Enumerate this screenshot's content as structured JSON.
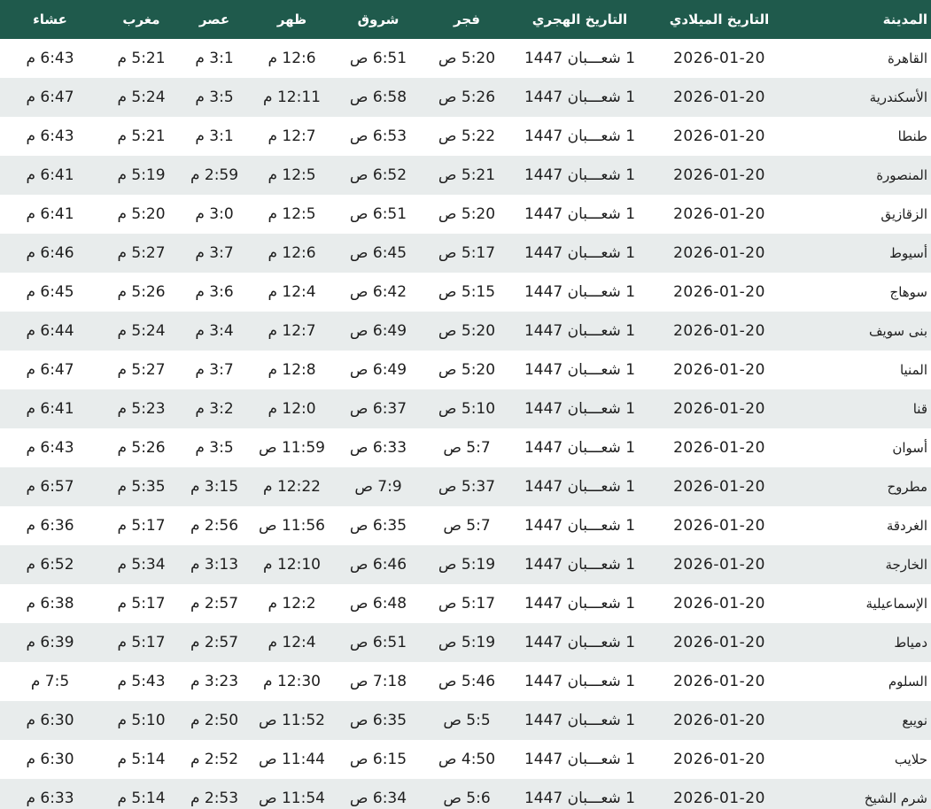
{
  "header": {
    "city": "المدينة",
    "gregorian": "التاريخ الميلادي",
    "hijri": "التاريخ الهجري",
    "fajr": "فجر",
    "sunrise": "شروق",
    "dhuhr": "ظهر",
    "asr": "عصر",
    "maghrib": "مغرب",
    "isha": "عشاء"
  },
  "rows": [
    {
      "city": "القاهرة",
      "gregorian": "2026-01-20",
      "hijri": "1 شعـــبان 1447",
      "fajr": "5:20 ص",
      "sunrise": "6:51 ص",
      "dhuhr": "12:6 م",
      "asr": "3:1 م",
      "maghrib": "5:21 م",
      "isha": "6:43 م"
    },
    {
      "city": "الأسكندرية",
      "gregorian": "2026-01-20",
      "hijri": "1 شعـــبان 1447",
      "fajr": "5:26 ص",
      "sunrise": "6:58 ص",
      "dhuhr": "12:11 م",
      "asr": "3:5 م",
      "maghrib": "5:24 م",
      "isha": "6:47 م"
    },
    {
      "city": "طنطا",
      "gregorian": "2026-01-20",
      "hijri": "1 شعـــبان 1447",
      "fajr": "5:22 ص",
      "sunrise": "6:53 ص",
      "dhuhr": "12:7 م",
      "asr": "3:1 م",
      "maghrib": "5:21 م",
      "isha": "6:43 م"
    },
    {
      "city": "المنصورة",
      "gregorian": "2026-01-20",
      "hijri": "1 شعـــبان 1447",
      "fajr": "5:21 ص",
      "sunrise": "6:52 ص",
      "dhuhr": "12:5 م",
      "asr": "2:59 م",
      "maghrib": "5:19 م",
      "isha": "6:41 م"
    },
    {
      "city": "الزقازيق",
      "gregorian": "2026-01-20",
      "hijri": "1 شعـــبان 1447",
      "fajr": "5:20 ص",
      "sunrise": "6:51 ص",
      "dhuhr": "12:5 م",
      "asr": "3:0 م",
      "maghrib": "5:20 م",
      "isha": "6:41 م"
    },
    {
      "city": "أسيوط",
      "gregorian": "2026-01-20",
      "hijri": "1 شعـــبان 1447",
      "fajr": "5:17 ص",
      "sunrise": "6:45 ص",
      "dhuhr": "12:6 م",
      "asr": "3:7 م",
      "maghrib": "5:27 م",
      "isha": "6:46 م"
    },
    {
      "city": "سوهاج",
      "gregorian": "2026-01-20",
      "hijri": "1 شعـــبان 1447",
      "fajr": "5:15 ص",
      "sunrise": "6:42 ص",
      "dhuhr": "12:4 م",
      "asr": "3:6 م",
      "maghrib": "5:26 م",
      "isha": "6:45 م"
    },
    {
      "city": "بنى سويف",
      "gregorian": "2026-01-20",
      "hijri": "1 شعـــبان 1447",
      "fajr": "5:20 ص",
      "sunrise": "6:49 ص",
      "dhuhr": "12:7 م",
      "asr": "3:4 م",
      "maghrib": "5:24 م",
      "isha": "6:44 م"
    },
    {
      "city": "المنيا",
      "gregorian": "2026-01-20",
      "hijri": "1 شعـــبان 1447",
      "fajr": "5:20 ص",
      "sunrise": "6:49 ص",
      "dhuhr": "12:8 م",
      "asr": "3:7 م",
      "maghrib": "5:27 م",
      "isha": "6:47 م"
    },
    {
      "city": "قنا",
      "gregorian": "2026-01-20",
      "hijri": "1 شعـــبان 1447",
      "fajr": "5:10 ص",
      "sunrise": "6:37 ص",
      "dhuhr": "12:0 م",
      "asr": "3:2 م",
      "maghrib": "5:23 م",
      "isha": "6:41 م"
    },
    {
      "city": "أسوان",
      "gregorian": "2026-01-20",
      "hijri": "1 شعـــبان 1447",
      "fajr": "5:7 ص",
      "sunrise": "6:33 ص",
      "dhuhr": "11:59 ص",
      "asr": "3:5 م",
      "maghrib": "5:26 م",
      "isha": "6:43 م"
    },
    {
      "city": "مطروح",
      "gregorian": "2026-01-20",
      "hijri": "1 شعـــبان 1447",
      "fajr": "5:37 ص",
      "sunrise": "7:9 ص",
      "dhuhr": "12:22 م",
      "asr": "3:15 م",
      "maghrib": "5:35 م",
      "isha": "6:57 م"
    },
    {
      "city": "الغردقة",
      "gregorian": "2026-01-20",
      "hijri": "1 شعـــبان 1447",
      "fajr": "5:7 ص",
      "sunrise": "6:35 ص",
      "dhuhr": "11:56 ص",
      "asr": "2:56 م",
      "maghrib": "5:17 م",
      "isha": "6:36 م"
    },
    {
      "city": "الخارجة",
      "gregorian": "2026-01-20",
      "hijri": "1 شعـــبان 1447",
      "fajr": "5:19 ص",
      "sunrise": "6:46 ص",
      "dhuhr": "12:10 م",
      "asr": "3:13 م",
      "maghrib": "5:34 م",
      "isha": "6:52 م"
    },
    {
      "city": "الإسماعيلية",
      "gregorian": "2026-01-20",
      "hijri": "1 شعـــبان 1447",
      "fajr": "5:17 ص",
      "sunrise": "6:48 ص",
      "dhuhr": "12:2 م",
      "asr": "2:57 م",
      "maghrib": "5:17 م",
      "isha": "6:38 م"
    },
    {
      "city": "دمياط",
      "gregorian": "2026-01-20",
      "hijri": "1 شعـــبان 1447",
      "fajr": "5:19 ص",
      "sunrise": "6:51 ص",
      "dhuhr": "12:4 م",
      "asr": "2:57 م",
      "maghrib": "5:17 م",
      "isha": "6:39 م"
    },
    {
      "city": "السلوم",
      "gregorian": "2026-01-20",
      "hijri": "1 شعـــبان 1447",
      "fajr": "5:46 ص",
      "sunrise": "7:18 ص",
      "dhuhr": "12:30 م",
      "asr": "3:23 م",
      "maghrib": "5:43 م",
      "isha": "7:5 م"
    },
    {
      "city": "نويبع",
      "gregorian": "2026-01-20",
      "hijri": "1 شعـــبان 1447",
      "fajr": "5:5 ص",
      "sunrise": "6:35 ص",
      "dhuhr": "11:52 ص",
      "asr": "2:50 م",
      "maghrib": "5:10 م",
      "isha": "6:30 م"
    },
    {
      "city": "حلايب",
      "gregorian": "2026-01-20",
      "hijri": "1 شعـــبان 1447",
      "fajr": "4:50 ص",
      "sunrise": "6:15 ص",
      "dhuhr": "11:44 ص",
      "asr": "2:52 م",
      "maghrib": "5:14 م",
      "isha": "6:30 م"
    },
    {
      "city": "شرم الشيخ",
      "gregorian": "2026-01-20",
      "hijri": "1 شعـــبان 1447",
      "fajr": "5:6 ص",
      "sunrise": "6:34 ص",
      "dhuhr": "11:54 ص",
      "asr": "2:53 م",
      "maghrib": "5:14 م",
      "isha": "6:33 م"
    }
  ]
}
